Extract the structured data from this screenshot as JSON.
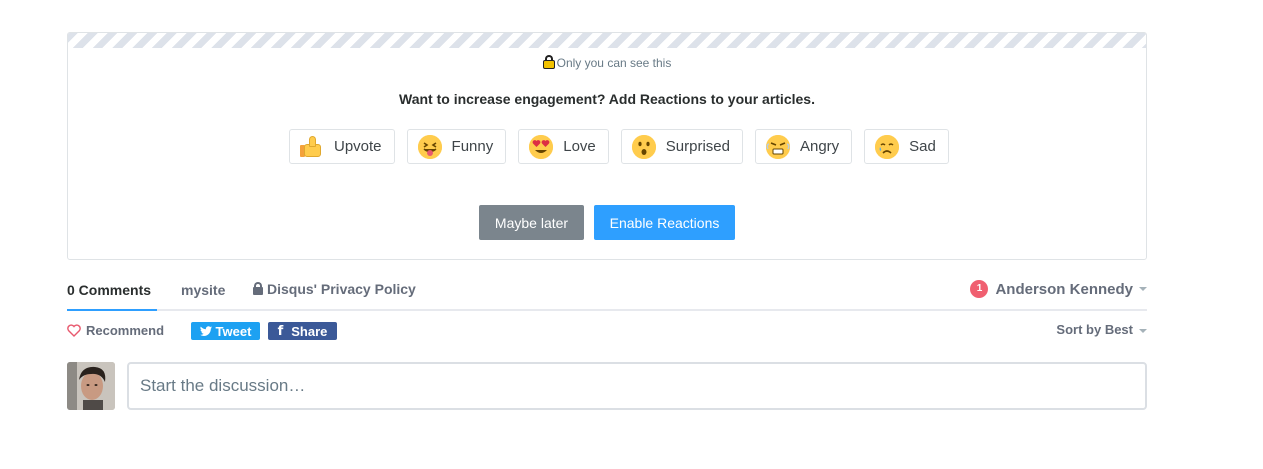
{
  "promo": {
    "private_note": "Only you can see this",
    "title": "Want to increase engagement? Add Reactions to your articles.",
    "reactions": [
      {
        "label": "Upvote",
        "icon": "thumbs-up-icon"
      },
      {
        "label": "Funny",
        "icon": "tongue-face-icon"
      },
      {
        "label": "Love",
        "icon": "heart-eyes-icon"
      },
      {
        "label": "Surprised",
        "icon": "surprised-face-icon"
      },
      {
        "label": "Angry",
        "icon": "angry-face-icon"
      },
      {
        "label": "Sad",
        "icon": "sad-face-icon"
      }
    ],
    "later_label": "Maybe later",
    "enable_label": "Enable Reactions"
  },
  "nav": {
    "comments_tab": "0 Comments",
    "site_tab": "mysite",
    "privacy_tab": "Disqus' Privacy Policy",
    "notification_count": "1",
    "user_name": "Anderson Kennedy"
  },
  "actions": {
    "recommend": "Recommend",
    "tweet": "Tweet",
    "share": "Share",
    "sort": "Sort by Best"
  },
  "composer": {
    "placeholder": "Start the discussion…"
  },
  "colors": {
    "accent": "#2e9fff",
    "tweet": "#1da1f2",
    "facebook": "#3b5998",
    "notification": "#f05f70",
    "secondary_button": "#7b858d"
  }
}
